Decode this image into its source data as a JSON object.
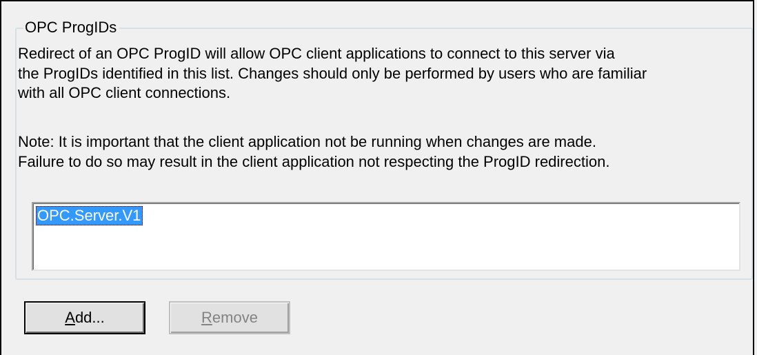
{
  "groupbox": {
    "title": "OPC ProgIDs"
  },
  "description": {
    "lines": [
      "Redirect of an OPC ProgID will allow OPC client applications to connect to this server via",
      "the ProgIDs identified in this list. Changes should only be performed by users who are familiar",
      "with all OPC client connections."
    ]
  },
  "note": {
    "lines": [
      "Note: It is important that the client application not be running when changes are made.",
      "Failure to do so may result in the client application not respecting the ProgID redirection."
    ]
  },
  "progid_list": {
    "items": [
      {
        "label": "OPC.Server.V1",
        "selected": true
      }
    ]
  },
  "buttons": {
    "add": {
      "mnemonic": "A",
      "rest": "dd...",
      "enabled": true
    },
    "remove": {
      "mnemonic": "R",
      "rest": "emove",
      "enabled": false
    }
  },
  "colors": {
    "selection": "#3399ff",
    "groupbox_border": "#d5dfe5",
    "background": "#f0f0f0"
  }
}
